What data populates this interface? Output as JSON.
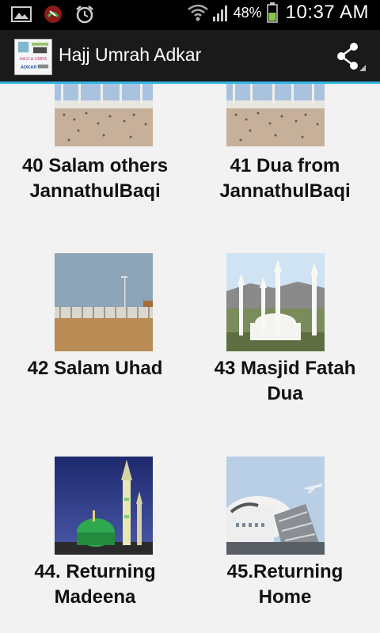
{
  "status_bar": {
    "battery_percent": "48%",
    "time": "10:37 AM",
    "icons": [
      "gallery-icon",
      "missed-call-icon",
      "alarm-icon",
      "wifi-icon",
      "signal-icon",
      "battery-icon"
    ]
  },
  "action_bar": {
    "title": "Hajj Umrah Adkar",
    "share_icon": "share-icon",
    "app_icon_text": {
      "line1": "HAJJ & UMRA",
      "line2": "ADKAR"
    }
  },
  "items": [
    {
      "line1": "40 Salam others",
      "line2": "JannathulBaqi",
      "image": "mosque-courtyard"
    },
    {
      "line1": "41 Dua from",
      "line2": "JannathulBaqi",
      "image": "mosque-courtyard"
    },
    {
      "line1": "42 Salam Uhad",
      "line2": "",
      "image": "desert-wall"
    },
    {
      "line1": "43 Masjid Fatah",
      "line2": "Dua",
      "image": "white-mosque"
    },
    {
      "line1": "44. Returning",
      "line2": "Madeena",
      "image": "green-dome-night"
    },
    {
      "line1": "45.Returning",
      "line2": "Home",
      "image": "airplane"
    }
  ],
  "colors": {
    "accent": "#33b5e5",
    "action_bar": "#1a1a1a",
    "background": "#f2f2f2"
  }
}
